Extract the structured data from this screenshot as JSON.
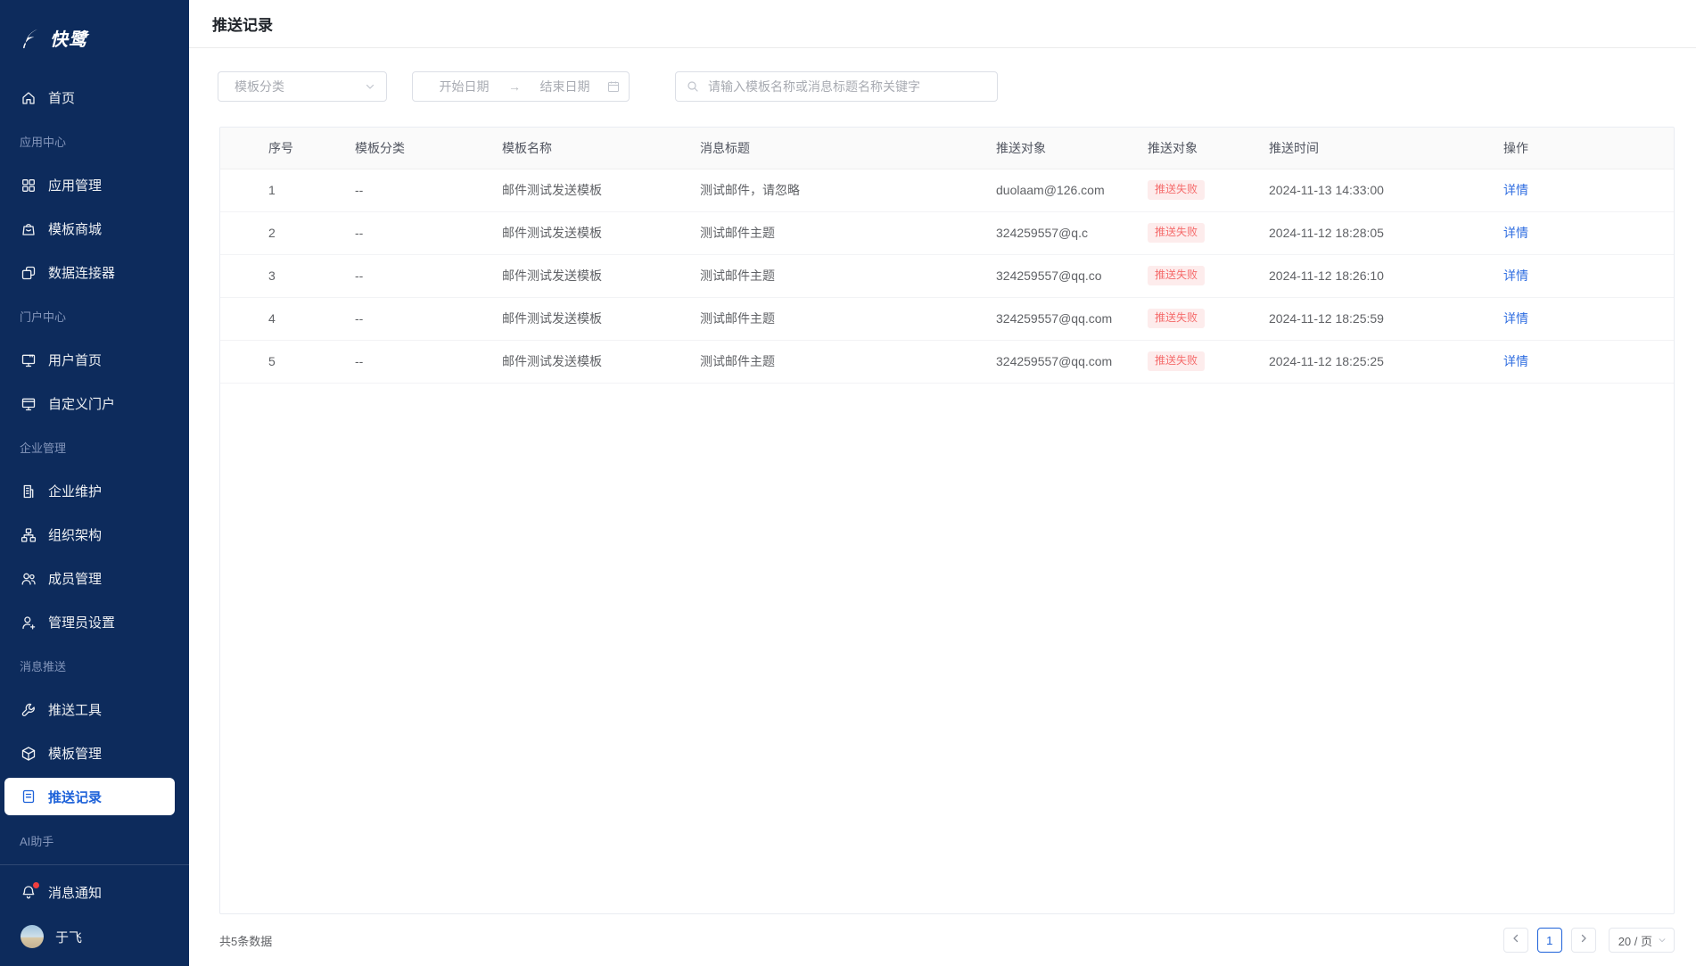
{
  "app": {
    "logo_text": "快鹭"
  },
  "colors": {
    "sidebar_bg": "#0d2b5c",
    "accent_blue": "#1e62d9",
    "link_blue": "#2f6de0",
    "status_fail_text": "#f56c6c",
    "status_fail_bg": "#fdecec",
    "notification_dot": "#f03e3e"
  },
  "sidebar": {
    "nav": [
      {
        "type": "item",
        "icon": "home-icon",
        "label": "首页"
      },
      {
        "type": "section",
        "label": "应用中心"
      },
      {
        "type": "item",
        "icon": "apps-icon",
        "label": "应用管理"
      },
      {
        "type": "item",
        "icon": "store-icon",
        "label": "模板商城"
      },
      {
        "type": "item",
        "icon": "connector-icon",
        "label": "数据连接器"
      },
      {
        "type": "section",
        "label": "门户中心"
      },
      {
        "type": "item",
        "icon": "monitor-icon",
        "label": "用户首页"
      },
      {
        "type": "item",
        "icon": "portal-icon",
        "label": "自定义门户"
      },
      {
        "type": "section",
        "label": "企业管理"
      },
      {
        "type": "item",
        "icon": "building-icon",
        "label": "企业维护"
      },
      {
        "type": "item",
        "icon": "org-icon",
        "label": "组织架构"
      },
      {
        "type": "item",
        "icon": "members-icon",
        "label": "成员管理"
      },
      {
        "type": "item",
        "icon": "admin-icon",
        "label": "管理员设置"
      },
      {
        "type": "section",
        "label": "消息推送"
      },
      {
        "type": "item",
        "icon": "wrench-icon",
        "label": "推送工具"
      },
      {
        "type": "item",
        "icon": "cube-icon",
        "label": "模板管理"
      },
      {
        "type": "item",
        "icon": "record-icon",
        "label": "推送记录",
        "active": true
      },
      {
        "type": "section",
        "label": "AI助手"
      }
    ],
    "bottom": [
      {
        "icon": "bell-icon",
        "label": "消息通知",
        "has_badge": true
      },
      {
        "icon": "avatar",
        "label": "于飞"
      }
    ]
  },
  "header": {
    "title": "推送记录"
  },
  "filters": {
    "category_placeholder": "模板分类",
    "date_start_placeholder": "开始日期",
    "date_end_placeholder": "结束日期",
    "search_placeholder": "请输入模板名称或消息标题名称关键字"
  },
  "table": {
    "columns": [
      "序号",
      "模板分类",
      "模板名称",
      "消息标题",
      "推送对象",
      "推送对象",
      "推送时间",
      "操作"
    ],
    "rows": [
      {
        "index": "1",
        "category": "--",
        "template": "邮件测试发送模板",
        "title": "测试邮件，请忽略",
        "target": "duolaam@126.com",
        "status": "推送失败",
        "time": "2024-11-13 14:33:00",
        "action": "详情"
      },
      {
        "index": "2",
        "category": "--",
        "template": "邮件测试发送模板",
        "title": "测试邮件主题",
        "target": "324259557@q.c",
        "status": "推送失败",
        "time": "2024-11-12 18:28:05",
        "action": "详情"
      },
      {
        "index": "3",
        "category": "--",
        "template": "邮件测试发送模板",
        "title": "测试邮件主题",
        "target": "324259557@qq.co",
        "status": "推送失败",
        "time": "2024-11-12 18:26:10",
        "action": "详情"
      },
      {
        "index": "4",
        "category": "--",
        "template": "邮件测试发送模板",
        "title": "测试邮件主题",
        "target": "324259557@qq.com",
        "status": "推送失败",
        "time": "2024-11-12 18:25:59",
        "action": "详情"
      },
      {
        "index": "5",
        "category": "--",
        "template": "邮件测试发送模板",
        "title": "测试邮件主题",
        "target": "324259557@qq.com",
        "status": "推送失败",
        "time": "2024-11-12 18:25:25",
        "action": "详情"
      }
    ]
  },
  "footer": {
    "total_text": "共5条数据",
    "current_page": "1",
    "page_size_text": "20 / 页"
  }
}
